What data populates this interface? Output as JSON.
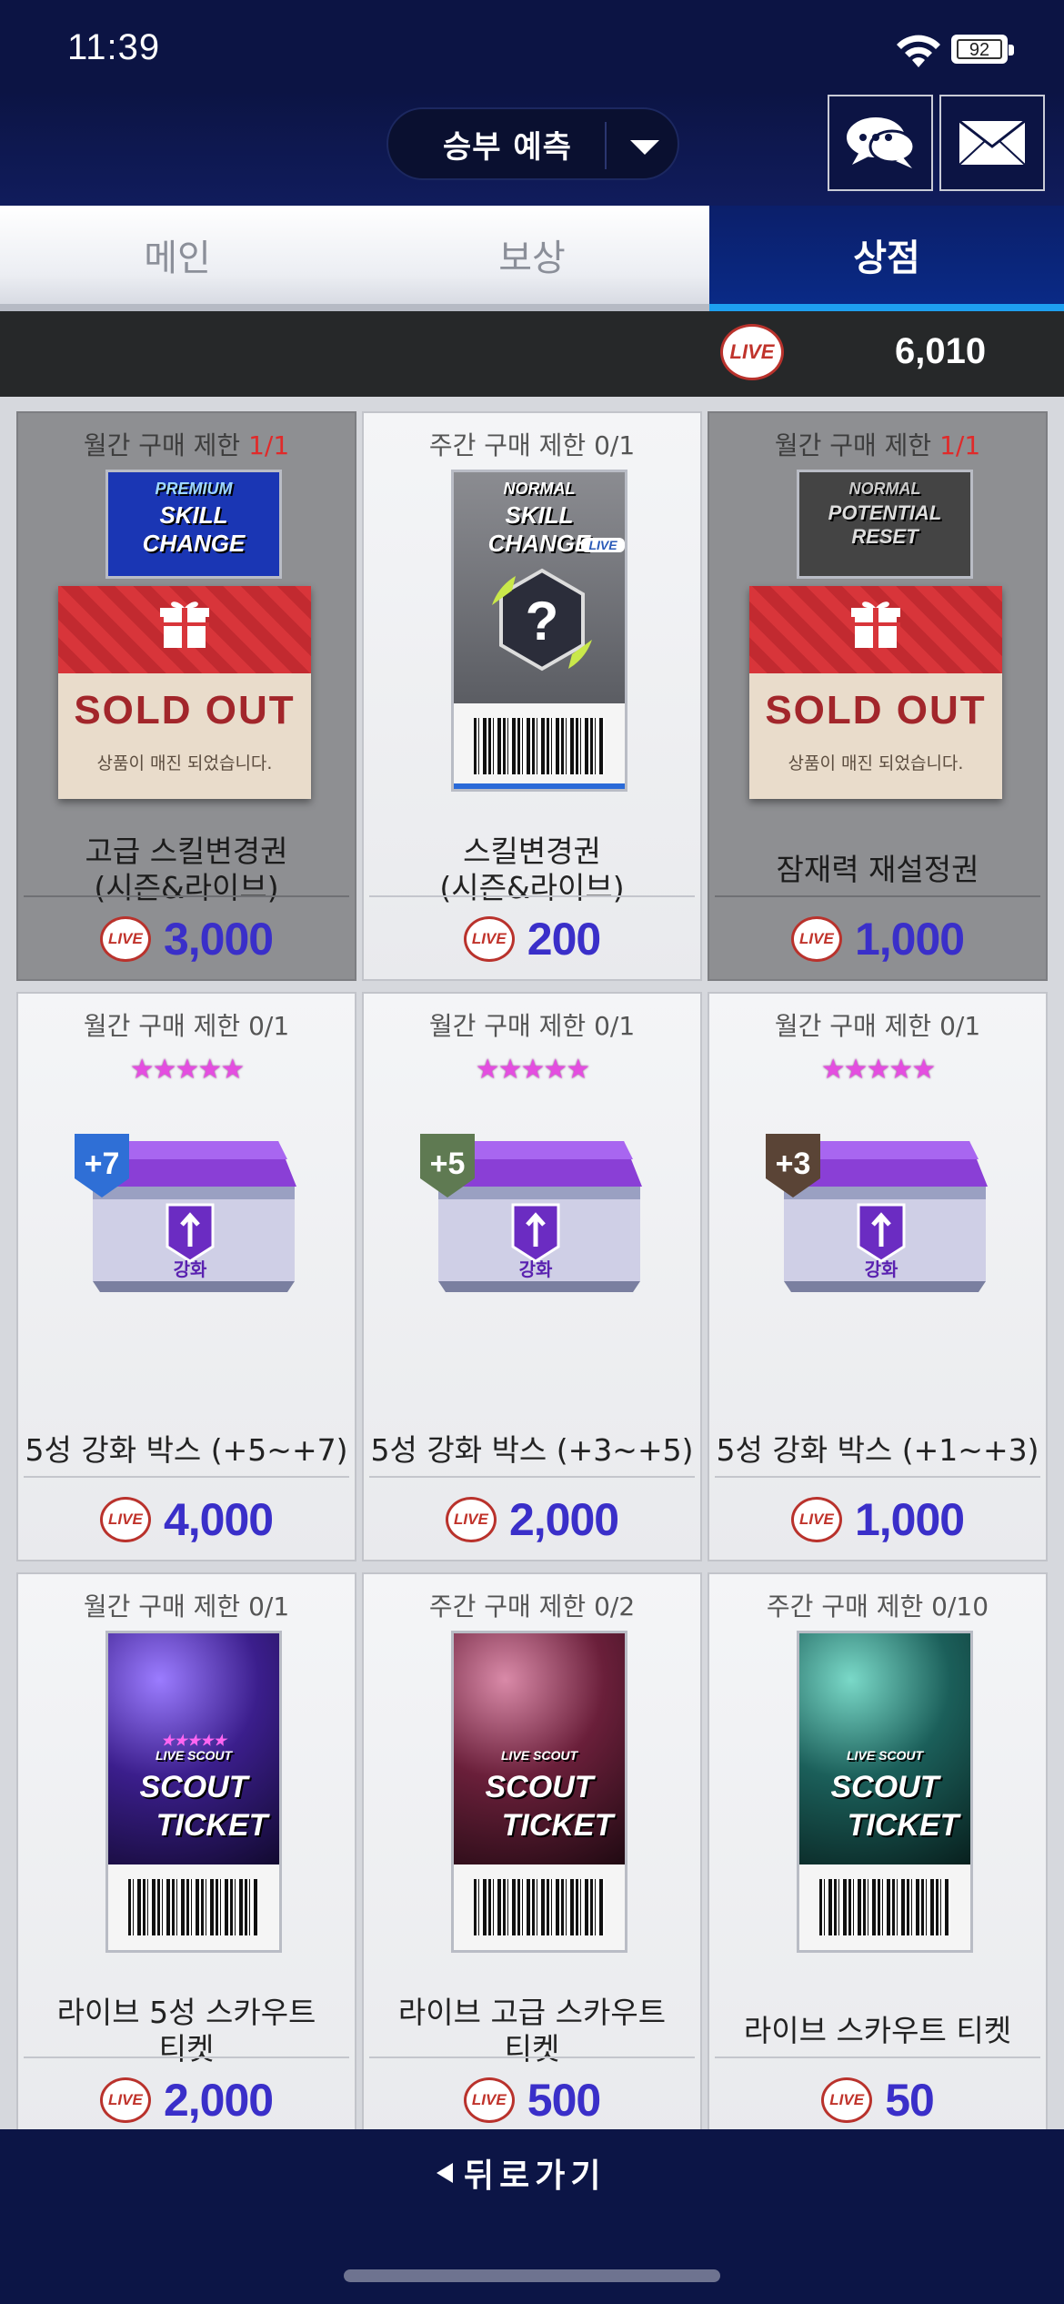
{
  "status": {
    "time": "11:39",
    "battery": "92"
  },
  "header": {
    "mode": "승부 예측"
  },
  "tabs": [
    {
      "label": "메인",
      "active": false
    },
    {
      "label": "보상",
      "active": false
    },
    {
      "label": "상점",
      "active": true
    }
  ],
  "currency": {
    "icon_text": "LIVE",
    "value": "6,010"
  },
  "items": [
    {
      "limit_prefix": "월간 구매 제한 ",
      "limit_used": "1",
      "limit_slash": "/",
      "limit_max": "1",
      "art": "premium-skill-change-ticket",
      "art_title_small": "PREMIUM",
      "art_title": "SKILL CHANGE",
      "sold_out": true,
      "name": "고급 스킬변경권\n(시즌&라이브)",
      "price": "3,000"
    },
    {
      "limit": "주간 구매 제한 0/1",
      "art": "normal-skill-change-ticket",
      "art_title_small": "NORMAL",
      "art_title": "SKILL CHANGE",
      "art_tag": "LIVE",
      "sold_out": false,
      "name": "스킬변경권\n(시즌&라이브)",
      "price": "200"
    },
    {
      "limit_prefix": "월간 구매 제한 ",
      "limit_used": "1",
      "limit_slash": "/",
      "limit_max": "1",
      "art": "normal-potential-reset-ticket",
      "art_title_small": "NORMAL",
      "art_title": "POTENTIAL RESET",
      "sold_out": true,
      "name": "잠재력 재설정권",
      "price": "1,000"
    },
    {
      "limit": "월간 구매 제한 0/1",
      "art": "upgrade-box",
      "badge": "+7",
      "badge_color": "#2f6fd6",
      "box_label": "강화",
      "stars": "★★★★★",
      "name": "5성 강화 박스 (+5~+7)",
      "price": "4,000"
    },
    {
      "limit": "월간 구매 제한 0/1",
      "art": "upgrade-box",
      "badge": "+5",
      "badge_color": "#5f7a52",
      "box_label": "강화",
      "stars": "★★★★★",
      "name": "5성 강화 박스 (+3~+5)",
      "price": "2,000"
    },
    {
      "limit": "월간 구매 제한 0/1",
      "art": "upgrade-box",
      "badge": "+3",
      "badge_color": "#5a4436",
      "box_label": "강화",
      "stars": "★★★★★",
      "name": "5성 강화 박스 (+1~+3)",
      "price": "1,000"
    },
    {
      "limit": "월간 구매 제한 0/1",
      "art": "scout-ticket",
      "ticket_stars": "★★★★★",
      "ticket_tag": "LIVE SCOUT",
      "ticket_title1": "SCOUT",
      "ticket_title2": "TICKET",
      "theme": "#3b1e8c",
      "name": "라이브 5성 스카우트\n티켓",
      "price": "2,000"
    },
    {
      "limit": "주간 구매 제한 0/2",
      "art": "scout-ticket",
      "ticket_tag": "LIVE SCOUT",
      "ticket_title1": "SCOUT",
      "ticket_title2": "TICKET",
      "theme": "#6a1f3a",
      "name": "라이브 고급 스카우트\n티켓",
      "price": "500"
    },
    {
      "limit": "주간 구매 제한 0/10",
      "art": "scout-ticket",
      "ticket_tag": "LIVE SCOUT",
      "ticket_title1": "SCOUT",
      "ticket_title2": "TICKET",
      "theme": "#1b5f5a",
      "name": "라이브 스카우트 티켓",
      "price": "50"
    }
  ],
  "soldout": {
    "title": "SOLD OUT",
    "subtitle": "상품이 매진 되었습니다."
  },
  "bottom": {
    "back_label": "뒤로가기"
  }
}
